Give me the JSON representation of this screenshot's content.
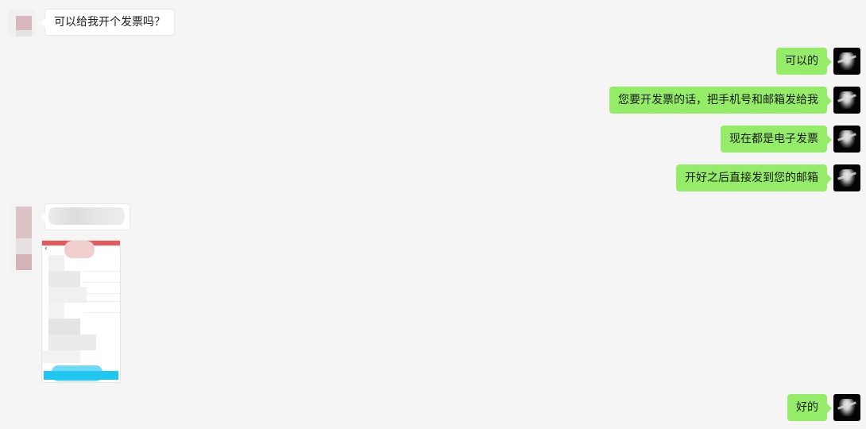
{
  "colors": {
    "background": "#f5f5f5",
    "self_bubble": "#95ec69",
    "other_bubble": "#ffffff"
  },
  "messages": [
    {
      "sender": "other",
      "type": "text",
      "text": "可以给我开个发票吗？"
    },
    {
      "sender": "self",
      "type": "text",
      "text": "可以的"
    },
    {
      "sender": "self",
      "type": "text",
      "text": "您要开发票的话，把手机号和邮箱发给我"
    },
    {
      "sender": "self",
      "type": "text",
      "text": "现在都是电子发票"
    },
    {
      "sender": "self",
      "type": "text",
      "text": "开好之后直接发到您的邮箱"
    },
    {
      "sender": "other",
      "type": "text",
      "text": ""
    },
    {
      "sender": "other",
      "type": "image"
    },
    {
      "sender": "self",
      "type": "text",
      "text": "好的"
    }
  ],
  "icons": {
    "self_avatar": "user-avatar-icon",
    "other_avatar": "contact-avatar-icon",
    "back_arrow": "chevron-left-icon"
  },
  "image_message": {
    "back_glyph": "‹"
  }
}
